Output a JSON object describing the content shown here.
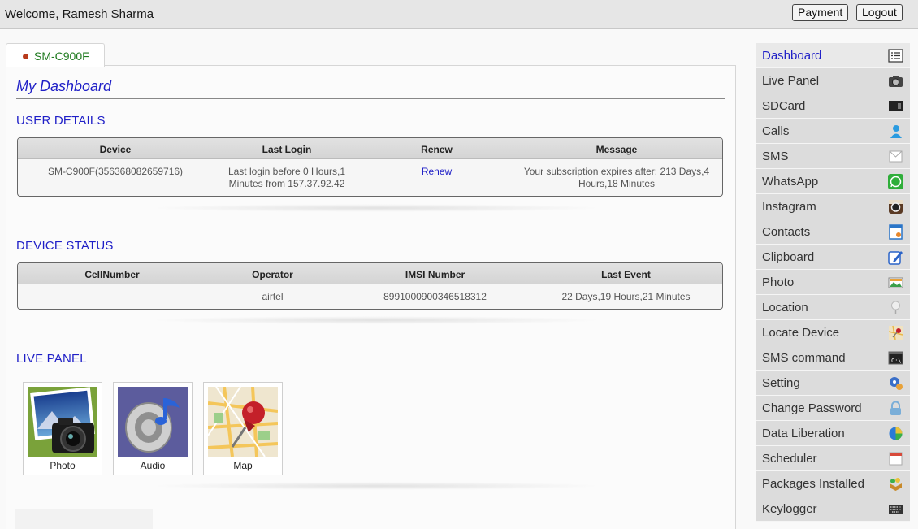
{
  "header": {
    "welcome_text": "Welcome, Ramesh Sharma",
    "payment_label": "Payment",
    "logout_label": "Logout"
  },
  "device_tab": {
    "label": "SM-C900F"
  },
  "dashboard": {
    "title": "My Dashboard"
  },
  "user_details": {
    "title": "USER DETAILS",
    "columns": [
      "Device",
      "Last Login",
      "Renew",
      "Message"
    ],
    "row": {
      "device": "SM-C900F(356368082659716)",
      "last_login_line1": "Last login before 0 Hours,1",
      "last_login_line2": "Minutes from 157.37.92.42",
      "renew": "Renew",
      "message_line1": "Your subscription expires after: 213 Days,4",
      "message_line2": "Hours,18 Minutes"
    }
  },
  "device_status": {
    "title": "DEVICE STATUS",
    "columns": [
      "CellNumber",
      "Operator",
      "IMSI Number",
      "Last Event"
    ],
    "row": {
      "cell_number": "",
      "operator": "airtel",
      "imsi": "8991000900346518312",
      "last_event": "22 Days,19 Hours,21 Minutes"
    }
  },
  "live_panel": {
    "title": "LIVE PANEL",
    "tiles": [
      {
        "label": "Photo",
        "icon": "camera-icon"
      },
      {
        "label": "Audio",
        "icon": "speaker-icon"
      },
      {
        "label": "Map",
        "icon": "map-pin-icon"
      }
    ]
  },
  "sidebar": {
    "items": [
      {
        "label": "Dashboard",
        "icon": "list-icon",
        "active": true
      },
      {
        "label": "Live Panel",
        "icon": "camera-icon"
      },
      {
        "label": "SDCard",
        "icon": "sdcard-icon"
      },
      {
        "label": "Calls",
        "icon": "person-icon"
      },
      {
        "label": "SMS",
        "icon": "envelope-icon"
      },
      {
        "label": "WhatsApp",
        "icon": "whatsapp-icon"
      },
      {
        "label": "Instagram",
        "icon": "instagram-icon"
      },
      {
        "label": "Contacts",
        "icon": "address-book-icon"
      },
      {
        "label": "Clipboard",
        "icon": "edit-icon"
      },
      {
        "label": "Photo",
        "icon": "photo-icon"
      },
      {
        "label": "Location",
        "icon": "location-pin-icon"
      },
      {
        "label": "Locate Device",
        "icon": "map-icon"
      },
      {
        "label": "SMS command",
        "icon": "terminal-icon"
      },
      {
        "label": "Setting",
        "icon": "settings-icon"
      },
      {
        "label": "Change Password",
        "icon": "lock-icon"
      },
      {
        "label": "Data Liberation",
        "icon": "pie-icon"
      },
      {
        "label": "Scheduler",
        "icon": "calendar-icon"
      },
      {
        "label": "Packages Installed",
        "icon": "package-icon"
      },
      {
        "label": "Keylogger",
        "icon": "keyboard-icon"
      }
    ]
  }
}
